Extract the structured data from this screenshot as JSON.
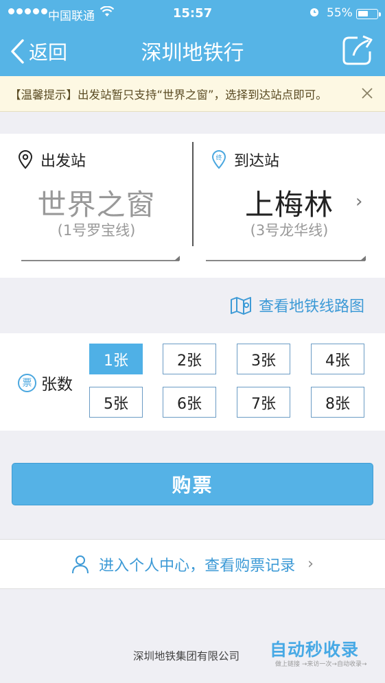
{
  "status_bar": {
    "carrier": "中国联通",
    "time": "15:57",
    "battery": "55%",
    "battery_level": 0.55
  },
  "nav": {
    "back_label": "返回",
    "title": "深圳地铁行"
  },
  "tip": {
    "text": "【温馨提示】出发站暂只支持“世界之窗”，选择到达站点即可。"
  },
  "stations": {
    "departure": {
      "label": "出发站",
      "name": "世界之窗",
      "line": "(1号罗宝线)"
    },
    "arrival": {
      "label": "到达站",
      "icon_text": "终",
      "name": "上梅林",
      "line": "(3号龙华线)"
    }
  },
  "map_link": "查看地铁线路图",
  "ticket_count": {
    "icon_text": "票",
    "label": "张数",
    "options": [
      "1张",
      "2张",
      "3张",
      "4张",
      "5张",
      "6张",
      "7张",
      "8张"
    ],
    "selected": "1张"
  },
  "buy_button": "购票",
  "personal_center": "进入个人中心，查看购票记录",
  "footer": "深圳地铁集团有限公司",
  "watermark": {
    "text": "自动秒收录",
    "subtext": "做上链接 →来访一次→自动收录→"
  },
  "colors": {
    "primary": "#56b4e6",
    "link": "#3d9ad6",
    "tip_bg": "#fdf8e3"
  }
}
